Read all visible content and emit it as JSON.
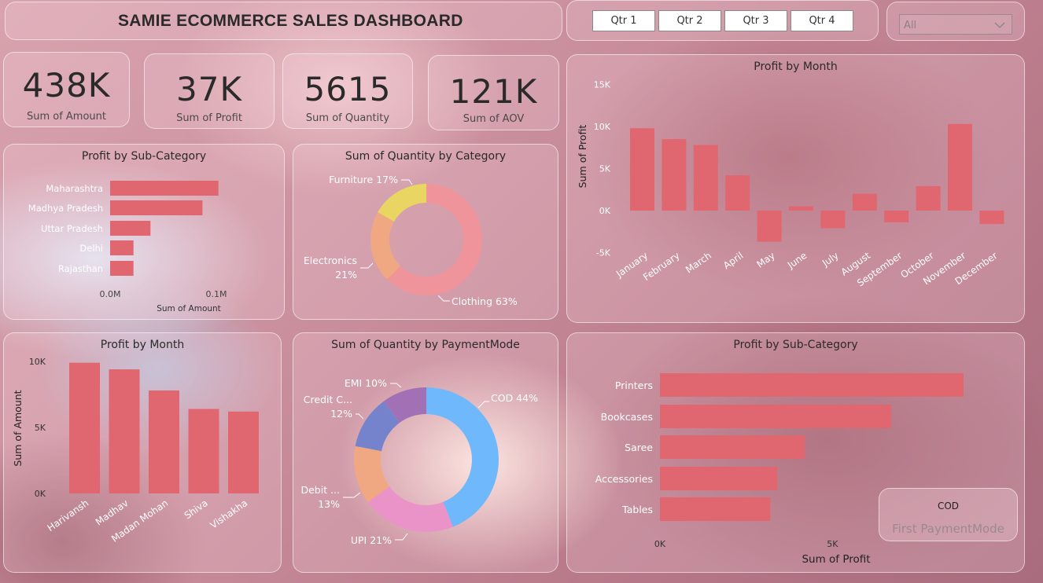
{
  "header": {
    "title": "SAMIE ECOMMERCE SALES DASHBOARD"
  },
  "quarters": [
    "Qtr 1",
    "Qtr 2",
    "Qtr 3",
    "Qtr 4"
  ],
  "slicer": {
    "selected": "All"
  },
  "kpis": [
    {
      "value": "438K",
      "label": "Sum of Amount"
    },
    {
      "value": "37K",
      "label": "Sum of Profit"
    },
    {
      "value": "5615",
      "label": "Sum of Quantity"
    },
    {
      "value": "121K",
      "label": "Sum of AOV"
    }
  ],
  "card": {
    "value": "COD",
    "label": "First PaymentMode"
  },
  "colors": {
    "bar": "#e06770",
    "furniture": "#e9d562",
    "electronics": "#f0a882",
    "clothing": "#ef949b",
    "cod": "#6fb8fb",
    "upi": "#ea93c9",
    "debit": "#f0a882",
    "credit": "#7583cd",
    "emi": "#a270b5"
  },
  "chart_data": [
    {
      "type": "bar",
      "orientation": "horizontal",
      "title": "Profit by Sub-Category",
      "xlabel": "Sum of Amount",
      "categories": [
        "Maharashtra",
        "Madhya Pradesh",
        "Uttar Pradesh",
        "Delhi",
        "Rajasthan"
      ],
      "values": [
        0.102,
        0.087,
        0.038,
        0.022,
        0.022
      ],
      "xticks": [
        "0.0M",
        "0.1M"
      ],
      "xlim": [
        0,
        0.11
      ]
    },
    {
      "type": "pie",
      "donut": true,
      "title": "Sum of Quantity by Category",
      "slices": [
        {
          "label": "Clothing",
          "pct": 63,
          "text": "Clothing 63%"
        },
        {
          "label": "Electronics",
          "pct": 21,
          "text1": "Electronics",
          "text2": "21%"
        },
        {
          "label": "Furniture",
          "pct": 17,
          "text": "Furniture 17%"
        }
      ]
    },
    {
      "type": "bar",
      "title": "Profit by Month",
      "ylabel": "Sum of Profit",
      "categories": [
        "January",
        "February",
        "March",
        "April",
        "May",
        "June",
        "July",
        "August",
        "September",
        "October",
        "November",
        "December"
      ],
      "values": [
        9800,
        8500,
        7800,
        4200,
        -3700,
        500,
        -2100,
        2000,
        -1400,
        2900,
        10300,
        -1600
      ],
      "yticks": [
        "15K",
        "10K",
        "5K",
        "0K",
        "-5K"
      ],
      "ylim": [
        -6000,
        16000
      ]
    },
    {
      "type": "bar",
      "title": "Profit by Month",
      "ylabel": "Sum of Amount",
      "categories": [
        "Harivansh",
        "Madhav",
        "Madan Mohan",
        "Shiva",
        "Vishakha"
      ],
      "values": [
        9900,
        9400,
        7800,
        6400,
        6200
      ],
      "yticks": [
        "10K",
        "5K",
        "0K"
      ],
      "ylim": [
        0,
        10300
      ]
    },
    {
      "type": "pie",
      "donut": true,
      "title": "Sum of Quantity by PaymentMode",
      "slices": [
        {
          "label": "COD",
          "pct": 44,
          "text": "COD 44%"
        },
        {
          "label": "UPI",
          "pct": 21,
          "text": "UPI 21%"
        },
        {
          "label": "Debit ...",
          "pct": 13,
          "text1": "Debit ...",
          "text2": "13%"
        },
        {
          "label": "Credit C...",
          "pct": 12,
          "text1": "Credit C...",
          "text2": "12%"
        },
        {
          "label": "EMI",
          "pct": 10,
          "text": "EMI 10%"
        }
      ]
    },
    {
      "type": "bar",
      "orientation": "horizontal",
      "title": "Profit by Sub-Category",
      "xlabel": "Sum of Profit",
      "categories": [
        "Printers",
        "Bookcases",
        "Saree",
        "Accessories",
        "Tables"
      ],
      "values": [
        8800,
        6700,
        4200,
        3400,
        3200
      ],
      "xticks": [
        "0K",
        "5K"
      ],
      "xlim": [
        0,
        8800
      ]
    }
  ]
}
